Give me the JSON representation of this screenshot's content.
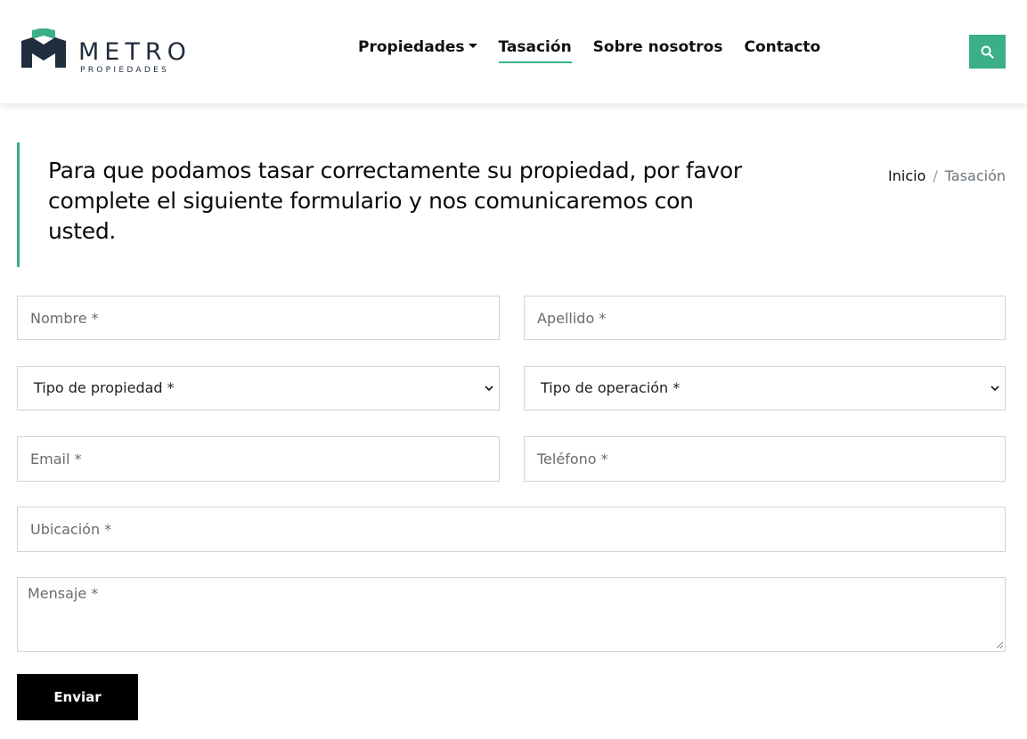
{
  "brand": {
    "name": "METRO",
    "tagline": "PROPIEDADES"
  },
  "nav": {
    "items": [
      {
        "label": "Propiedades"
      },
      {
        "label": "Tasación"
      },
      {
        "label": "Sobre nosotros"
      },
      {
        "label": "Contacto"
      }
    ]
  },
  "hero": {
    "title": "Para que podamos tasar correctamente su propiedad, por favor complete el siguiente formulario y nos comunicaremos con usted."
  },
  "breadcrumb": {
    "home": "Inicio",
    "separator": "/",
    "current": "Tasación"
  },
  "form": {
    "nombre_placeholder": "Nombre *",
    "apellido_placeholder": "Apellido *",
    "tipo_propiedad": "Tipo de propiedad *",
    "tipo_operacion": "Tipo de operación *",
    "email_placeholder": "Email *",
    "telefono_placeholder": "Teléfono *",
    "ubicacion_placeholder": "Ubicación *",
    "mensaje_placeholder": "Mensaje *",
    "submit_label": "Enviar"
  },
  "colors": {
    "accent": "#3aaf8a",
    "dark": "#1f2d3d",
    "button": "#000000"
  },
  "icons": {
    "search": "search-icon",
    "caret": "caret-down-icon",
    "chevron": "chevron-down-icon"
  }
}
